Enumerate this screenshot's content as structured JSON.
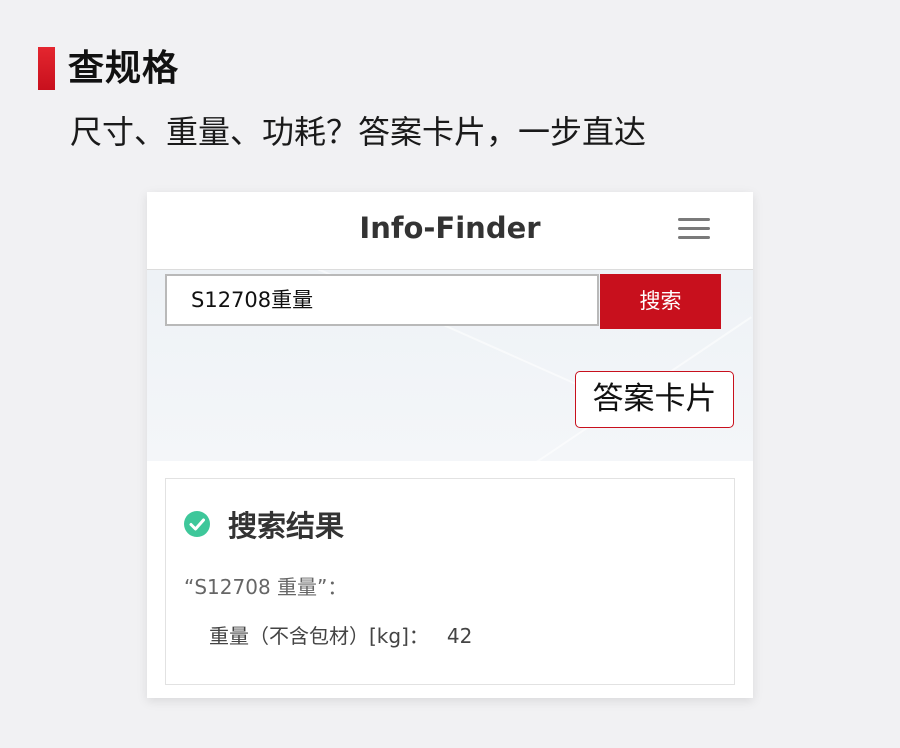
{
  "page": {
    "title": "查规格",
    "subtitle": "尺寸、重量、功耗？答案卡片，一步直达"
  },
  "colors": {
    "accent": "#c8101d",
    "check": "#3ec79a"
  },
  "app": {
    "title": "Info-Finder",
    "menu_icon": "hamburger-menu-icon"
  },
  "search": {
    "value": "S12708重量",
    "button_label": "搜索"
  },
  "answer_card": {
    "label": "答案卡片"
  },
  "result": {
    "heading": "搜索结果",
    "query_text": "“S12708 重量”：",
    "spec_label": "重量（不含包材）[kg]：",
    "spec_value": "42",
    "status_icon": "check-circle-icon"
  }
}
